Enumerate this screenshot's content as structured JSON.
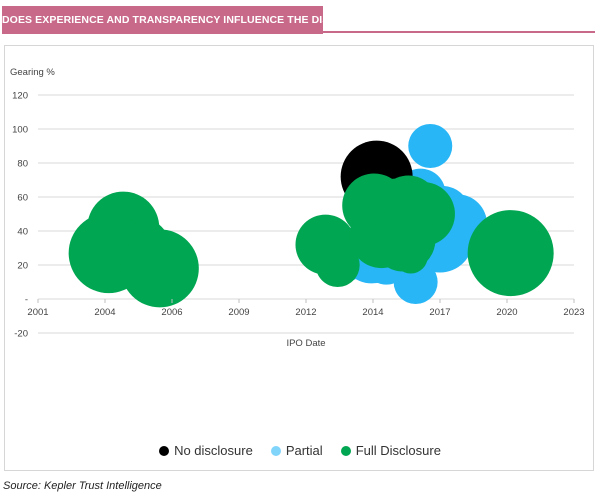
{
  "header": {
    "title": "DOES EXPERIENCE AND TRANSPARENCY INFLUENCE THE DISCOUNT?"
  },
  "source": "Source: Kepler Trust Intelligence",
  "colors": {
    "header_bg": "#c8698a",
    "no_disclosure": "#000000",
    "partial": "#29b6f6",
    "full": "#00a651"
  },
  "chart_data": {
    "type": "scatter",
    "subtype": "bubble",
    "title": "",
    "xlabel": "IPO Date",
    "ylabel": "Gearing %",
    "xlim": [
      2001,
      2023
    ],
    "ylim": [
      -20,
      120
    ],
    "x_ticks": [
      "2001",
      "2004",
      "2006",
      "2009",
      "2012",
      "2014",
      "2017",
      "2020",
      "2023"
    ],
    "y_ticks": [
      "120",
      "100",
      "80",
      "60",
      "40",
      "20",
      "-",
      "-20"
    ],
    "grid": true,
    "legend_position": "bottom",
    "series": [
      {
        "name": "Partial",
        "color": "#29b6f6",
        "points": [
          {
            "x": 2017.1,
            "y": 90,
            "r": 22
          },
          {
            "x": 2016.7,
            "y": 62,
            "r": 25
          },
          {
            "x": 2017.6,
            "y": 50,
            "r": 28
          },
          {
            "x": 2018.2,
            "y": 44,
            "r": 30
          },
          {
            "x": 2017.5,
            "y": 35,
            "r": 33
          },
          {
            "x": 2015.4,
            "y": 40,
            "r": 27
          },
          {
            "x": 2014.7,
            "y": 28,
            "r": 32
          },
          {
            "x": 2015.3,
            "y": 22,
            "r": 23
          },
          {
            "x": 2016.5,
            "y": 10,
            "r": 22
          },
          {
            "x": 2013.6,
            "y": 25,
            "r": 25
          },
          {
            "x": 2017.8,
            "y": 28,
            "r": 18
          }
        ]
      },
      {
        "name": "No disclosure",
        "color": "#000000",
        "points": [
          {
            "x": 2014.9,
            "y": 72,
            "r": 36
          }
        ]
      },
      {
        "name": "Full Disclosure",
        "color": "#00a651",
        "points": [
          {
            "x": 2004.5,
            "y": 42,
            "r": 36
          },
          {
            "x": 2005.2,
            "y": 30,
            "r": 30
          },
          {
            "x": 2003.9,
            "y": 27,
            "r": 40
          },
          {
            "x": 2006.0,
            "y": 18,
            "r": 39
          },
          {
            "x": 2013.3,
            "y": 20,
            "r": 22
          },
          {
            "x": 2012.8,
            "y": 32,
            "r": 30
          },
          {
            "x": 2015.7,
            "y": 52,
            "r": 32
          },
          {
            "x": 2014.8,
            "y": 55,
            "r": 32
          },
          {
            "x": 2016.2,
            "y": 55,
            "r": 30
          },
          {
            "x": 2016.8,
            "y": 50,
            "r": 32
          },
          {
            "x": 2015.1,
            "y": 37,
            "r": 32
          },
          {
            "x": 2016.0,
            "y": 35,
            "r": 32
          },
          {
            "x": 2016.3,
            "y": 25,
            "r": 17
          },
          {
            "x": 2020.4,
            "y": 27,
            "r": 43
          }
        ]
      }
    ],
    "legend": [
      {
        "label": "No disclosure",
        "color": "#000000"
      },
      {
        "label": "Partial",
        "color": "#81d4fa"
      },
      {
        "label": "Full Disclosure",
        "color": "#00a651"
      }
    ]
  }
}
